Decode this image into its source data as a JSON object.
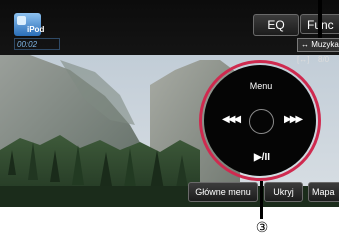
{
  "header": {
    "source_name": "iPod",
    "elapsed_time": "00:02",
    "eq_label": "EQ",
    "func_label": "Func",
    "source_text": "Muzyka",
    "track_count": "8/0"
  },
  "control_pad": {
    "menu_label": "Menu",
    "prev_glyph": "◀◀◀",
    "next_glyph": "▶▶▶",
    "play_pause_label": "▶/II"
  },
  "bottom_bar": {
    "main_menu_label": "Główne menu",
    "hide_label": "Ukryj",
    "map_label": "Mapa"
  },
  "callout": {
    "number": "③"
  }
}
